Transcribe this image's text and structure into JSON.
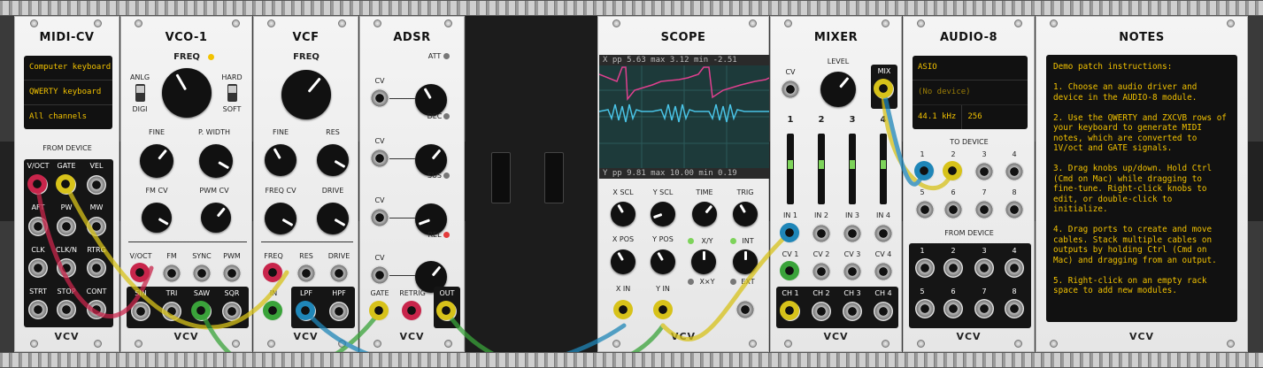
{
  "modules": {
    "midicv": {
      "title": "MIDI-CV",
      "lcd": [
        "Computer keyboard",
        "QWERTY keyboard",
        "All channels"
      ],
      "from_device": "FROM DEVICE",
      "ports": [
        "V/OCT",
        "GATE",
        "VEL",
        "AFT",
        "PW",
        "MW",
        "CLK",
        "CLK/N",
        "RTRG",
        "STRT",
        "STOP",
        "CONT"
      ]
    },
    "vco": {
      "title": "VCO-1",
      "freq": "FREQ",
      "anlg": "ANLG",
      "digi": "DIGI",
      "hard": "HARD",
      "soft": "SOFT",
      "fine": "FINE",
      "pwidth": "P. WIDTH",
      "fmcv": "FM CV",
      "pwmcv": "PWM CV",
      "in_ports": [
        "V/OCT",
        "FM",
        "SYNC",
        "PWM"
      ],
      "out_ports": [
        "SIN",
        "TRI",
        "SAW",
        "SQR"
      ]
    },
    "vcf": {
      "title": "VCF",
      "freq": "FREQ",
      "fine": "FINE",
      "res": "RES",
      "freqcv": "FREQ CV",
      "drive": "DRIVE",
      "in_ports": [
        "FREQ",
        "RES",
        "DRIVE"
      ],
      "in": "IN",
      "lpf": "LPF",
      "hpf": "HPF"
    },
    "adsr": {
      "title": "ADSR",
      "knobs": [
        "ATT",
        "DEC",
        "SUS",
        "REL"
      ],
      "cv": "CV",
      "bottom": [
        "GATE",
        "RETRIG",
        "OUT"
      ]
    },
    "scope": {
      "title": "SCOPE",
      "top_readout": "X   pp   5.63   max   3.12  min  -2.51",
      "bottom_readout": "Y   pp   9.81   max  10.00  min   0.19",
      "xscl": "X SCL",
      "yscl": "Y SCL",
      "time": "TIME",
      "trig": "TRIG",
      "xpos": "X POS",
      "ypos": "Y POS",
      "xy": "X/Y",
      "xxy": "X×Y",
      "int": "INT",
      "ext": "EXT",
      "xin": "X IN",
      "yin": "Y IN"
    },
    "mixer": {
      "title": "MIXER",
      "level": "LEVEL",
      "cv": "CV",
      "mix": "MIX",
      "channels": [
        "1",
        "2",
        "3",
        "4"
      ],
      "in_ports": [
        "IN 1",
        "IN 2",
        "IN 3",
        "IN 4"
      ],
      "cv_ports": [
        "CV 1",
        "CV 2",
        "CV 3",
        "CV 4"
      ],
      "ch_ports": [
        "CH 1",
        "CH 2",
        "CH 3",
        "CH 4"
      ]
    },
    "audio": {
      "title": "AUDIO-8",
      "driver": "ASIO",
      "device": "(No device)",
      "rate": "44.1 kHz",
      "block": "256",
      "to_device": "TO DEVICE",
      "from_device": "FROM DEVICE",
      "nums": [
        "1",
        "2",
        "3",
        "4",
        "5",
        "6",
        "7",
        "8"
      ]
    },
    "notes": {
      "title": "NOTES",
      "text": "Demo patch instructions:\n\n1. Choose an audio driver and device in the AUDIO-8 module.\n\n2. Use the QWERTY and ZXCVB rows of your keyboard to generate MIDI notes, which are converted to 1V/oct and GATE signals.\n\n3. Drag knobs up/down. Hold Ctrl (Cmd on Mac) while dragging to fine-tune. Right-click knobs to edit, or double-click to initialize.\n\n4. Drag ports to create and move cables. Stack multiple cables on outputs by holding Ctrl (Cmd on Mac) and dragging from an output.\n\n5. Right-click on an empty rack space to add new modules."
    }
  },
  "brand": "VCV",
  "colors": {
    "lcd_text": "#f2c200",
    "cable_red": "#c8254b",
    "cable_yellow": "#d7c21a",
    "cable_green": "#3aa33a",
    "cable_blue": "#1f86b8",
    "scope_pink": "#e0408f",
    "scope_cyan": "#49c3e6"
  }
}
